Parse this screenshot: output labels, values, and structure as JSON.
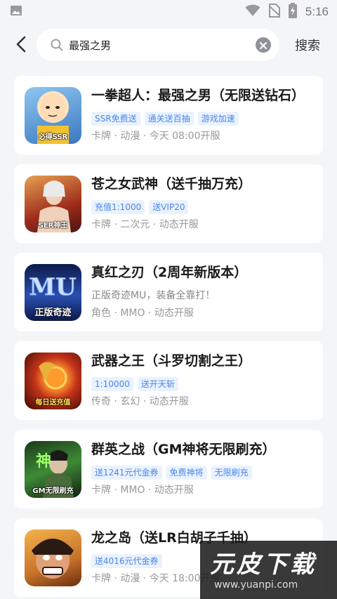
{
  "status_bar": {
    "time": "5:16",
    "icons": [
      "image-notification-icon",
      "wifi-icon",
      "no-sim-icon",
      "battery-charging-icon"
    ]
  },
  "search": {
    "query": "最强之男",
    "submit_label": "搜索"
  },
  "results": [
    {
      "title": "一拳超人：最强之男（无限送钻石）",
      "tags": [
        "SSR免费送",
        "通关送百抽",
        "游戏加速"
      ],
      "description": "",
      "meta": "卡牌 · 动漫 · 今天 08:00开服",
      "thumb_text": "必得SSR",
      "thumb_color": "#7fb8e8"
    },
    {
      "title": "苍之女武神（送千抽万充）",
      "tags": [
        "充值1:1000",
        "送VIP20"
      ],
      "description": "",
      "meta": "卡牌 · 二次元 · 动态开服",
      "thumb_text": "SER神王",
      "thumb_color": "#b83a2a"
    },
    {
      "title": "真红之刃（2周年新版本）",
      "tags": [],
      "description": "正版奇迹MU，装备全靠打！",
      "meta": "角色 · MMO · 动态开服",
      "thumb_text": "正版奇迹",
      "thumb_color": "#2b3f8c"
    },
    {
      "title": "武器之王（斗罗切割之王）",
      "tags": [
        "1:10000",
        "送开天斩"
      ],
      "description": "",
      "meta": "传奇 · 玄幻 · 动态开服",
      "thumb_text": "每日送充值",
      "thumb_color": "#c4431d"
    },
    {
      "title": "群英之战（GM神将无限刷充）",
      "tags": [
        "送1241元代金券",
        "免费神将",
        "无限刷充"
      ],
      "description": "",
      "meta": "卡牌 · MMO · 动态开服",
      "thumb_text": "GM无限刷充",
      "thumb_color": "#2f6b2c"
    },
    {
      "title": "龙之岛（送LR白胡子千抽）",
      "tags": [
        "送4016元代金券"
      ],
      "description": "",
      "meta": "卡牌 · 动漫 · 今天 18:00开服",
      "thumb_text": "",
      "thumb_color": "#c8732a"
    }
  ],
  "watermark": {
    "brand": "元皮下载",
    "url": "www.yuanpi.com"
  },
  "colors": {
    "tag_text": "#4a86e8",
    "tag_bg": "#eaf2fe",
    "page_bg": "#f4f5f7"
  }
}
